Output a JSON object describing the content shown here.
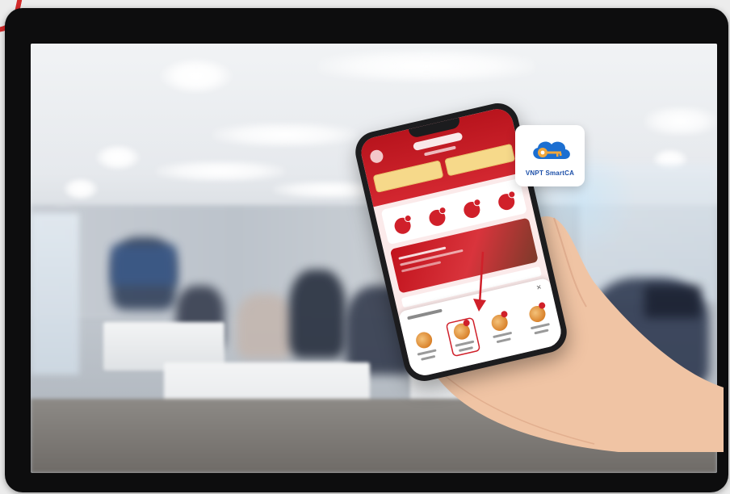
{
  "badge": {
    "label": "VNPT SmartCA",
    "icon": "cloud-key-icon",
    "colors": {
      "cloud": "#1c6fd1",
      "key": "#f2a73b",
      "text": "#1c4fa8"
    }
  },
  "app": {
    "accent": "#d0202a",
    "header_gradient": [
      "#b8141d",
      "#d32730"
    ],
    "service_icons": [
      "service-icon-1",
      "service-icon-2",
      "service-icon-3",
      "service-icon-4"
    ],
    "sheet_items": [
      "sheet-item-1",
      "sheet-item-2",
      "sheet-item-3",
      "sheet-item-4",
      "sheet-item-5"
    ],
    "highlighted_sheet_item": 1
  },
  "frame": {
    "accent_color": "#d42a2a",
    "bezel_color": "#0d0d0e"
  }
}
